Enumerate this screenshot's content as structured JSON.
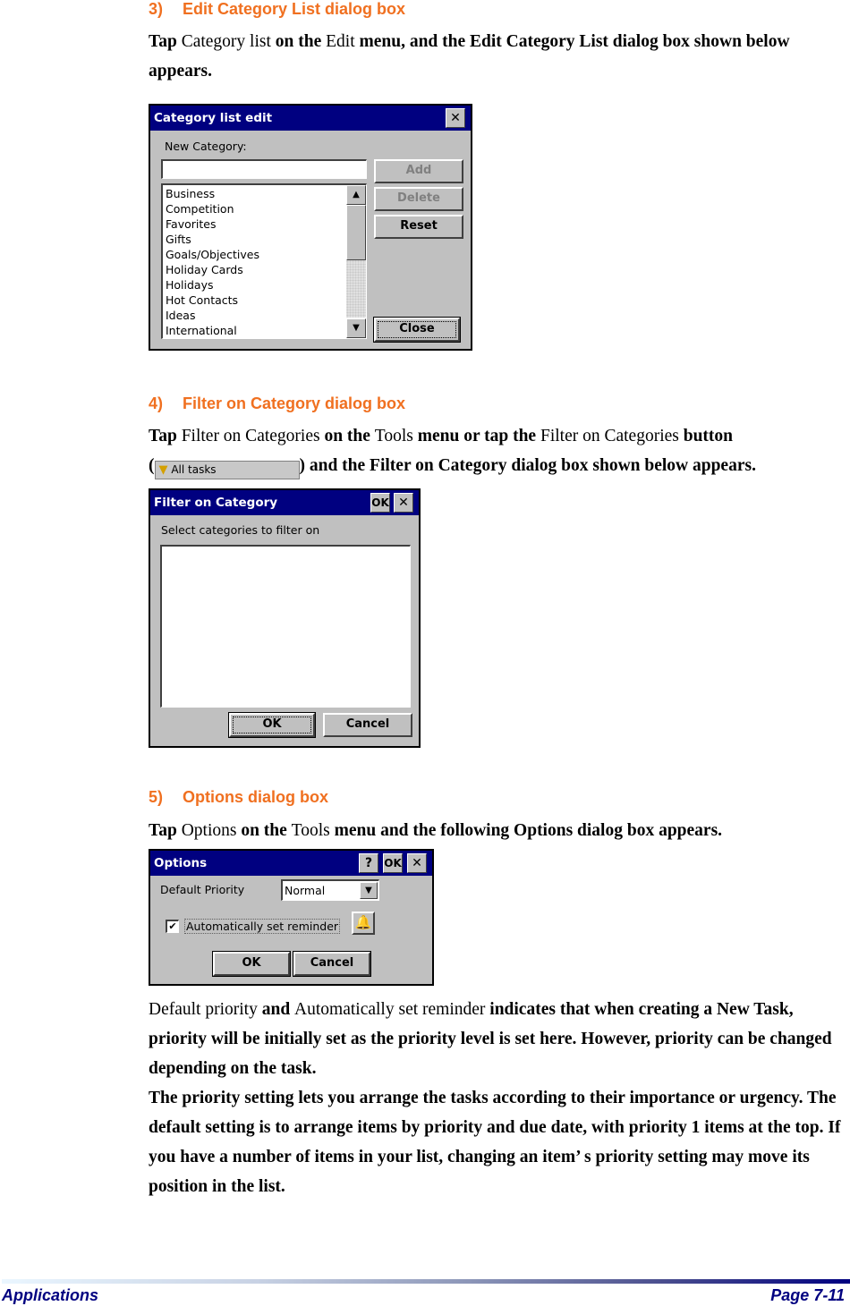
{
  "section3": {
    "number": "3)",
    "title": "Edit Category List dialog box",
    "para": {
      "t1": "Tap ",
      "t2": "Category list",
      "t3": " on the ",
      "t4": "Edit",
      "t5": " menu, and the Edit Category List dialog box shown below appears."
    },
    "dialog": {
      "title": "Category list edit",
      "close_glyph": "✕",
      "new_category_label": "New Category:",
      "new_category_value": "",
      "buttons": {
        "add": "Add",
        "delete": "Delete",
        "reset": "Reset",
        "close": "Close"
      },
      "categories": [
        "Business",
        "Competition",
        "Favorites",
        "Gifts",
        "Goals/Objectives",
        "Holiday Cards",
        "Holidays",
        "Hot Contacts",
        "Ideas",
        "International"
      ],
      "scroll_up_glyph": "▲",
      "scroll_down_glyph": "▼"
    }
  },
  "section4": {
    "number": "4)",
    "title": "Filter on Category dialog box",
    "para": {
      "t1": "Tap ",
      "t2": "Filter on Categories",
      "t3": " on the ",
      "t4": "Tools",
      "t5": " menu or tap the ",
      "t6": "Filter on Categories",
      "t7": " button",
      "open_paren": "(",
      "inline_button_label": "All tasks",
      "t8": ") and the Filter on Category dialog box shown below appears."
    },
    "dialog": {
      "title": "Filter on Category",
      "ok_glyph": "OK",
      "close_glyph": "✕",
      "instruction": "Select categories to filter on",
      "buttons": {
        "ok": "OK",
        "cancel": "Cancel"
      }
    }
  },
  "section5": {
    "number": "5)",
    "title": "Options dialog box",
    "para": {
      "t1": "Tap ",
      "t2": "Options",
      "t3": " on the ",
      "t4": "Tools",
      "t5": " menu and the following Options dialog box appears."
    },
    "dialog": {
      "title": "Options",
      "help_glyph": "?",
      "ok_glyph": "OK",
      "close_glyph": "✕",
      "default_priority_label": "Default Priority",
      "default_priority_value": "Normal",
      "reminder_label": "Automatically set reminder",
      "reminder_checked": true,
      "check_glyph": "✔",
      "dropdown_glyph": "▼",
      "buttons": {
        "ok": "OK",
        "cancel": "Cancel"
      }
    },
    "desc": {
      "d1": "Default priority",
      "d2": " and ",
      "d3": "Automatically set reminder",
      "d4": " indicates that when creating a New Task, priority will be initially set as the priority level is set here. However, priority can be changed depending on the task.",
      "d5": "The priority setting lets you arrange the tasks according to their importance or urgency. The default setting is to arrange items by priority and due date, with priority 1 items at the top. If you have a number of items in your list, changing an item’ s priority setting may move its position in the list."
    }
  },
  "footer": {
    "left": "Applications",
    "right": "Page 7-11",
    "gradient_end_color": "#000080"
  }
}
